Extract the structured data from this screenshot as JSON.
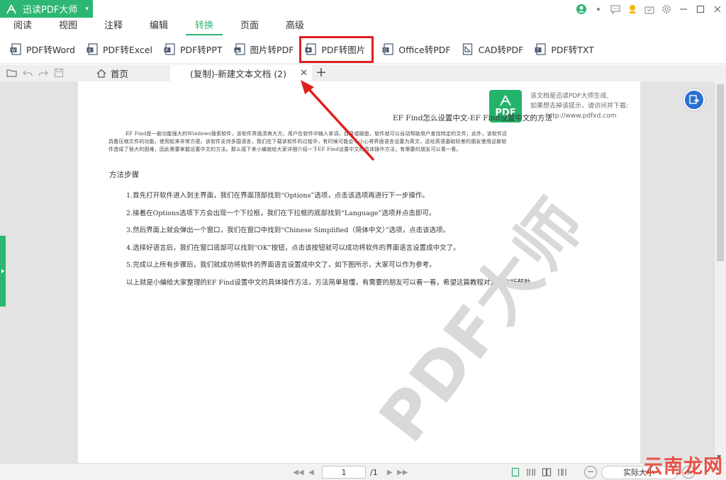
{
  "app": {
    "title": "迅读PDF大师",
    "brand_color": "#2cb673"
  },
  "menu": {
    "tabs": [
      "阅读",
      "视图",
      "注释",
      "编辑",
      "转换",
      "页面",
      "高级"
    ],
    "active": "转换"
  },
  "tools": [
    {
      "label": "PDF转Word",
      "icon": "pdf-to-word-icon"
    },
    {
      "label": "PDF转Excel",
      "icon": "pdf-to-excel-icon"
    },
    {
      "label": "PDF转PPT",
      "icon": "pdf-to-ppt-icon"
    },
    {
      "label": "图片转PDF",
      "icon": "image-to-pdf-icon"
    },
    {
      "label": "PDF转图片",
      "icon": "pdf-to-image-icon",
      "highlighted": true
    },
    {
      "label": "Office转PDF",
      "icon": "office-to-pdf-icon"
    },
    {
      "label": "CAD转PDF",
      "icon": "cad-to-pdf-icon"
    },
    {
      "label": "PDF转TXT",
      "icon": "pdf-to-txt-icon"
    }
  ],
  "tabs": {
    "home": "首页",
    "document": "(复制)-新建文本文档 (2)"
  },
  "document": {
    "badge_text": "PDF",
    "watermark_line1": "该文档是迅读PDF大师生成,",
    "watermark_line2": "如果想去掉该提示，请访问并下载:",
    "watermark_url": "http://www.pdfxd.com",
    "title": "EF Find怎么设置中文-EF Find设置中文的方法",
    "intro": "EF Find是一款功能强大的Windows搜索软件，该软件界面清爽大方，用户在软件中输入单词、目录或磁盘，软件就可以自动帮助用户查找特定的文件；此外，该软件还具备压缩文件的功能，使用起来非常方便。该软件支持多国语言，我们在下载该软件的过程中，有时候可能会不小心将界面语言设置为英文，这给英语基础较差的朋友使用这款软件造成了很大的困难，因此需要掌握设置中文的方法。那么接下来小编就给大家详细介绍一下EF Find设置中文的具体操作方法，有需要的朋友可以看一看。",
    "section": "方法步骤",
    "steps": [
      "1.首先打开软件进入到主界面，我们在界面顶部找到“Options”选项，点击该选项再进行下一步操作。",
      "2.接着在Options选项下方会出现一个下拉框，我们在下拉框的底部找到“Language”选项并点击即可。",
      "3.然后界面上就会弹出一个窗口，我们在窗口中找到“Chinese Simplified（简体中文）”选项，点击该选项。",
      "4.选择好语言后，我们在窗口底部可以找到“OK”按钮，点击该按钮就可以成功将软件的界面语言设置成中文了。",
      "5.完成以上所有步骤后，我们就成功将软件的界面语言设置成中文了，如下图所示，大家可以作为参考。"
    ],
    "outro": "以上就是小编给大家整理的EF Find设置中文的具体操作方法，方法简单易懂，有需要的朋友可以看一看，希望这篇教程对大家有所帮助。",
    "big_watermark": "PDF大师"
  },
  "status": {
    "page_value": "1",
    "page_total": "/1",
    "zoom_label": "实际大小"
  },
  "site_watermark": "云南龙网",
  "annotation": {
    "color": "#e02020"
  }
}
